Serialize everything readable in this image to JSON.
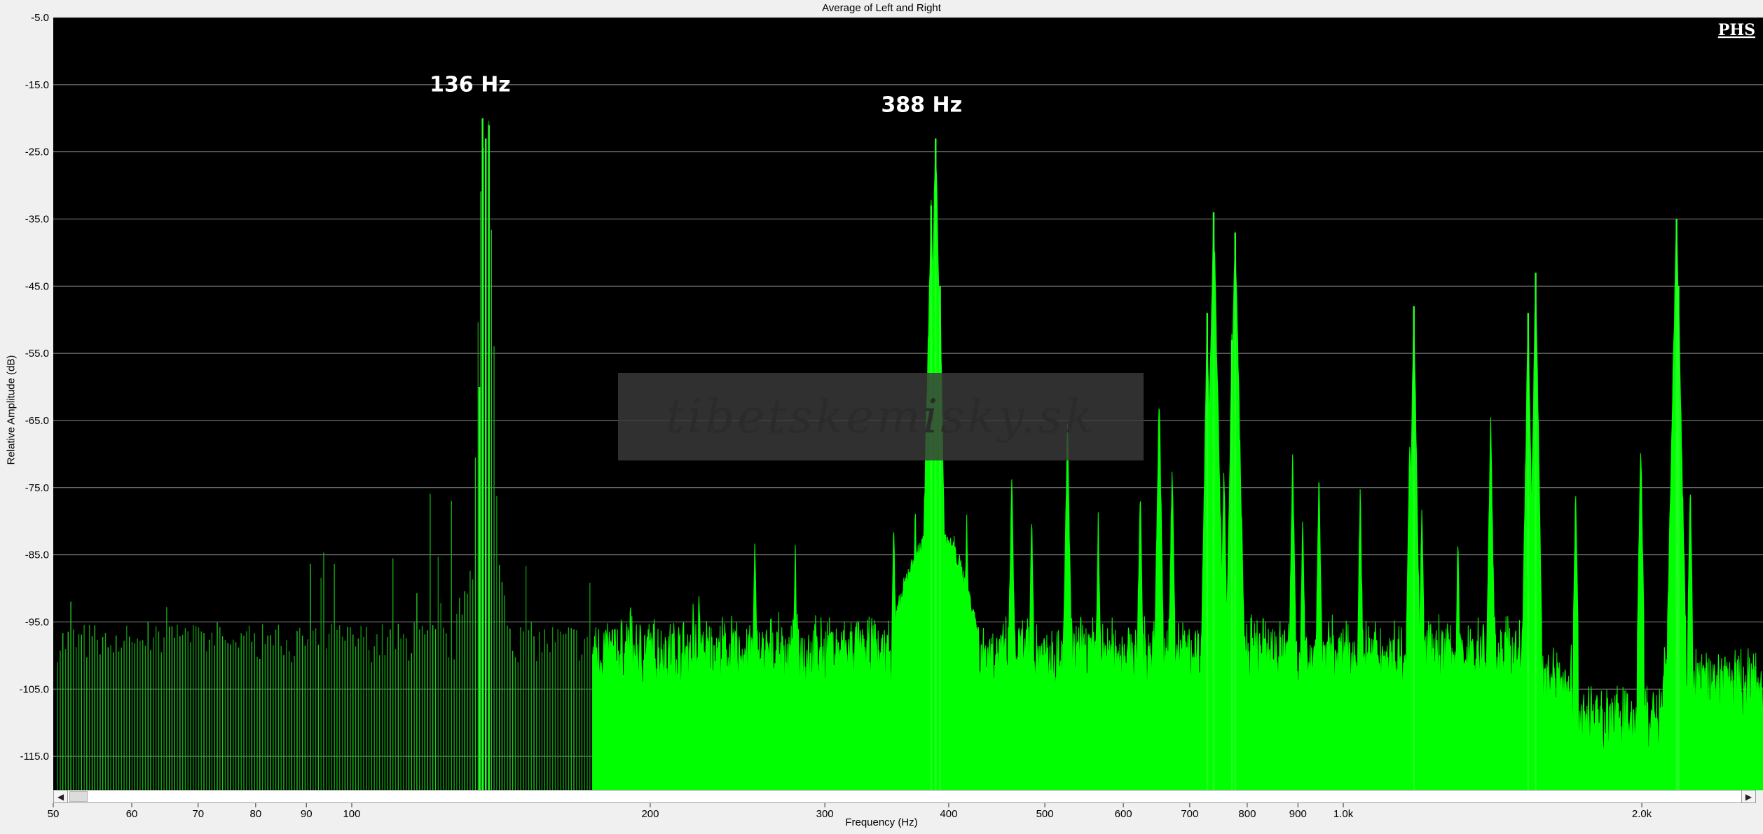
{
  "chart_data": {
    "type": "area",
    "title": "Average of Left and Right",
    "xlabel": "Frequency (Hz)",
    "ylabel": "Relative Amplitude (dB)",
    "x_scale": "log",
    "xlim": [
      50,
      2650
    ],
    "ylim": [
      -120,
      -5
    ],
    "y_ticks": [
      "-5.0",
      "-15.0",
      "-25.0",
      "-35.0",
      "-45.0",
      "-55.0",
      "-65.0",
      "-75.0",
      "-85.0",
      "-95.0",
      "-105.0",
      "-115.0"
    ],
    "x_ticks": [
      {
        "value": 50,
        "label": "50"
      },
      {
        "value": 60,
        "label": "60"
      },
      {
        "value": 70,
        "label": "70"
      },
      {
        "value": 80,
        "label": "80"
      },
      {
        "value": 90,
        "label": "90"
      },
      {
        "value": 100,
        "label": "100"
      },
      {
        "value": 200,
        "label": "200"
      },
      {
        "value": 300,
        "label": "300"
      },
      {
        "value": 400,
        "label": "400"
      },
      {
        "value": 500,
        "label": "500"
      },
      {
        "value": 600,
        "label": "600"
      },
      {
        "value": 700,
        "label": "700"
      },
      {
        "value": 800,
        "label": "800"
      },
      {
        "value": 900,
        "label": "900"
      },
      {
        "value": 1000,
        "label": "1.0k"
      },
      {
        "value": 2000,
        "label": "2.0k"
      }
    ],
    "grid": "horizontal",
    "background": "#000000",
    "series_color": "#00ff00",
    "floor_db": -98,
    "peaks": [
      {
        "x": 52,
        "y": -87
      },
      {
        "x": 59.5,
        "y": -93
      },
      {
        "x": 65,
        "y": -89
      },
      {
        "x": 68,
        "y": -91
      },
      {
        "x": 79,
        "y": -93
      },
      {
        "x": 91,
        "y": -81
      },
      {
        "x": 93.5,
        "y": -76
      },
      {
        "x": 96,
        "y": -83
      },
      {
        "x": 103,
        "y": -89
      },
      {
        "x": 110,
        "y": -86
      },
      {
        "x": 116,
        "y": -81
      },
      {
        "x": 120,
        "y": -77
      },
      {
        "x": 122.5,
        "y": -79
      },
      {
        "x": 126,
        "y": -78
      },
      {
        "x": 133,
        "y": -75
      },
      {
        "x": 134.5,
        "y": -60
      },
      {
        "x": 135.5,
        "y": -20
      },
      {
        "x": 136.5,
        "y": -23
      },
      {
        "x": 137.5,
        "y": -21
      },
      {
        "x": 138.5,
        "y": -65
      },
      {
        "x": 140.5,
        "y": -77
      },
      {
        "x": 150,
        "y": -83
      },
      {
        "x": 157,
        "y": -89
      },
      {
        "x": 174,
        "y": -88
      },
      {
        "x": 191,
        "y": -91
      },
      {
        "x": 221,
        "y": -92
      },
      {
        "x": 224,
        "y": -89
      },
      {
        "x": 255,
        "y": -83
      },
      {
        "x": 280,
        "y": -84
      },
      {
        "x": 352,
        "y": -80
      },
      {
        "x": 370,
        "y": -78
      },
      {
        "x": 380,
        "y": -65
      },
      {
        "x": 384,
        "y": -33
      },
      {
        "x": 388,
        "y": -23
      },
      {
        "x": 392,
        "y": -45
      },
      {
        "x": 405,
        "y": -81
      },
      {
        "x": 417,
        "y": -79
      },
      {
        "x": 463,
        "y": -73
      },
      {
        "x": 485,
        "y": -79
      },
      {
        "x": 527,
        "y": -65
      },
      {
        "x": 566,
        "y": -80
      },
      {
        "x": 624,
        "y": -75
      },
      {
        "x": 652,
        "y": -61
      },
      {
        "x": 672,
        "y": -71
      },
      {
        "x": 729,
        "y": -49
      },
      {
        "x": 740,
        "y": -34
      },
      {
        "x": 758,
        "y": -72
      },
      {
        "x": 772,
        "y": -53
      },
      {
        "x": 778,
        "y": -37
      },
      {
        "x": 889,
        "y": -70
      },
      {
        "x": 910,
        "y": -80
      },
      {
        "x": 945,
        "y": -73
      },
      {
        "x": 1040,
        "y": -76
      },
      {
        "x": 1167,
        "y": -67
      },
      {
        "x": 1178,
        "y": -48
      },
      {
        "x": 1200,
        "y": -78
      },
      {
        "x": 1305,
        "y": -83
      },
      {
        "x": 1408,
        "y": -65
      },
      {
        "x": 1536,
        "y": -49
      },
      {
        "x": 1563,
        "y": -43
      },
      {
        "x": 1715,
        "y": -75
      },
      {
        "x": 1995,
        "y": -68
      },
      {
        "x": 2168,
        "y": -35
      },
      {
        "x": 2178,
        "y": -45
      },
      {
        "x": 2238,
        "y": -75
      }
    ],
    "annotations": [
      {
        "label": "136 Hz",
        "x": 136
      },
      {
        "label": "388 Hz",
        "x": 388
      }
    ]
  },
  "logo_text": "PHS",
  "watermark_text": "tibetskemisky.sk",
  "scrollbar": {
    "left_arrow": "◀",
    "right_arrow": "▶"
  },
  "icons": {
    "scroll_left": "arrow-left-icon",
    "scroll_right": "arrow-right-icon"
  }
}
